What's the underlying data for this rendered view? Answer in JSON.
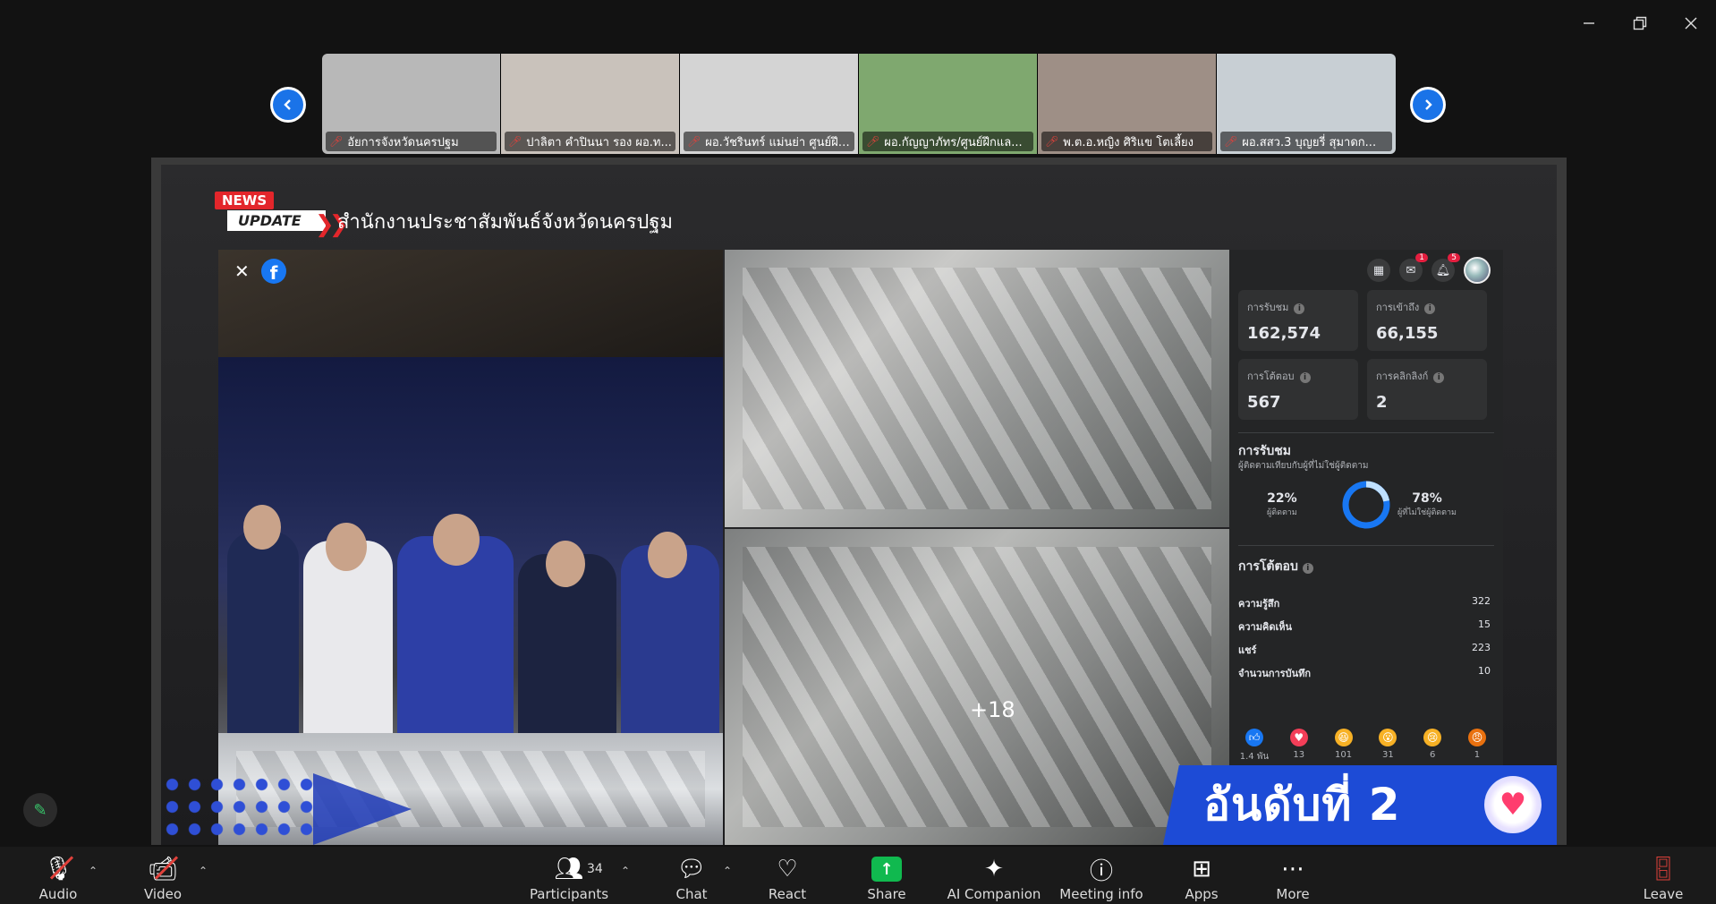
{
  "thumbnails": [
    {
      "name": "อัยการจังหวัดนครปฐม",
      "bg": "#b8b8b8"
    },
    {
      "name": "ปาลิตา คำปินนา รอง ผอ.ท...",
      "bg": "#c9c2bb"
    },
    {
      "name": "ผอ.วัชรินทร์ แม่นย่า ศูนย์ฝึกฯ...",
      "bg": "#d4d4d4"
    },
    {
      "name": "ผอ.กัญญาภัทร/ศูนย์ฝึกแล...",
      "bg": "#7fa86f"
    },
    {
      "name": "พ.ต.อ.หญิง ศิริแข  โตเลี้ยง",
      "bg": "#9e8f86"
    },
    {
      "name": "ผอ.สสว.3 บุญยรี่ สุมาดก...",
      "bg": "#c8cfd4"
    }
  ],
  "slide": {
    "news_label": "NEWS",
    "update_label": "UPDATE",
    "title": "สำนักงานประชาสัมพันธ์จังหวัดนครปฐม",
    "more_photos": "+18",
    "rank_text": "อันดับที่ 2"
  },
  "insights": {
    "badges": {
      "messenger": "1",
      "notifications": "5"
    },
    "reach_label": "การรับชม",
    "reach_value": "162,574",
    "engagement_label": "การเข้าถึง",
    "engagement_value": "66,155",
    "interactions_label": "การโต้ตอบ",
    "interactions_value": "567",
    "link_clicks_label": "การคลิกลิงก์",
    "link_clicks_value": "2",
    "views_title": "การรับชม",
    "views_subtitle": "ผู้ติดตามเทียบกับผู้ที่ไม่ใช่ผู้ติดตาม",
    "followers_pct": "22%",
    "followers_label": "ผู้ติดตาม",
    "non_followers_pct": "78%",
    "non_followers_label": "ผู้ที่ไม่ใช่ผู้ติดตาม",
    "followers_fraction": 0.22,
    "interactions_title": "การโต้ตอบ",
    "rows": [
      {
        "label": "ความรู้สึก",
        "value": "322"
      },
      {
        "label": "ความคิดเห็น",
        "value": "15"
      },
      {
        "label": "แชร์",
        "value": "223"
      },
      {
        "label": "จำนวนการบันทึก",
        "value": "10"
      }
    ],
    "reactions": [
      {
        "icon": "like-icon",
        "count": "1.4 พัน",
        "color": "#1877f2"
      },
      {
        "icon": "love-icon",
        "count": "13",
        "color": "#f33e58"
      },
      {
        "icon": "haha-icon",
        "count": "101",
        "color": "#f7b125"
      },
      {
        "icon": "wow-icon",
        "count": "31",
        "color": "#f7b125"
      },
      {
        "icon": "sad-icon",
        "count": "6",
        "color": "#f7b125"
      },
      {
        "icon": "angry-icon",
        "count": "1",
        "color": "#e9710f"
      }
    ]
  },
  "toolbar": {
    "audio": "Audio",
    "video": "Video",
    "participants": "Participants",
    "participants_count": "34",
    "chat": "Chat",
    "react": "React",
    "share": "Share",
    "ai_companion": "AI Companion",
    "meeting_info": "Meeting info",
    "apps": "Apps",
    "more": "More",
    "leave": "Leave"
  },
  "colors": {
    "accent": "#1a73e8",
    "share_green": "#10b94f",
    "muted_red": "#e0413b",
    "rank_blue": "#1d4bd6"
  }
}
